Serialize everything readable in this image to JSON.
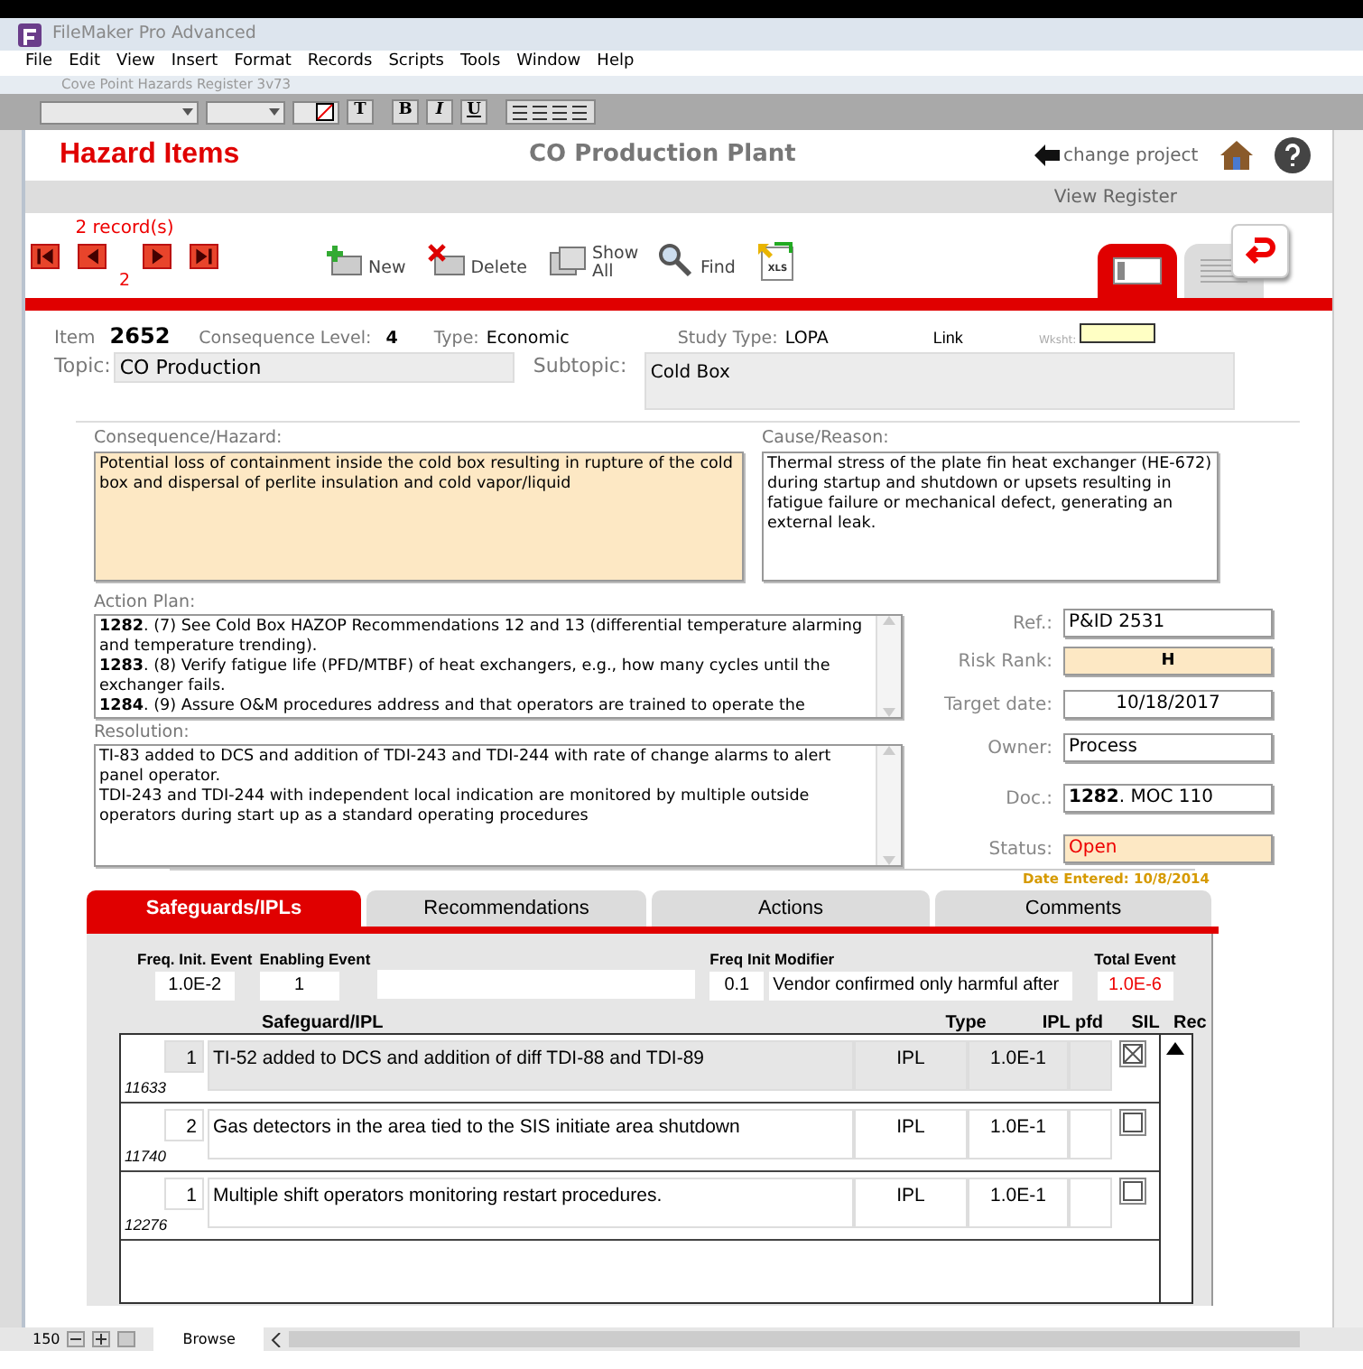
{
  "app_title": "FileMaker Pro Advanced",
  "menu": [
    "File",
    "Edit",
    "View",
    "Insert",
    "Format",
    "Records",
    "Scripts",
    "Tools",
    "Window",
    "Help"
  ],
  "document_title": "Cove Point Hazards Register 3v73",
  "format_buttons": [
    "T",
    "B",
    "I",
    "U"
  ],
  "header": {
    "title": "Hazard Items",
    "plant": "CO Production Plant",
    "change_project": "change project"
  },
  "subheader": "View Register",
  "records": {
    "count": "2 record(s)",
    "current": "2"
  },
  "toolbar": [
    {
      "kind": "new",
      "label": "New"
    },
    {
      "kind": "delete",
      "label": "Delete"
    },
    {
      "kind": "show_all",
      "label": "Show All"
    },
    {
      "kind": "find",
      "label": "Find"
    },
    {
      "kind": "xls",
      "label": "XLS"
    }
  ],
  "view_tabs": [
    {
      "kind": "form",
      "selected": true
    },
    {
      "kind": "list",
      "selected": false
    }
  ],
  "item": {
    "item_label": "Item",
    "item": "2652",
    "level_label": "Consequence Level:",
    "level": "4",
    "type_label": "Type:",
    "type": "Economic",
    "study_label": "Study Type:",
    "study": "LOPA",
    "link": "Link",
    "wksht": "Wksht:"
  },
  "topic": {
    "label": "Topic:",
    "value": "CO Production"
  },
  "subtopic": {
    "label": "Subtopic:",
    "value": "Cold Box"
  },
  "consequence": {
    "label": "Consequence/Hazard:",
    "value": "Potential loss of containment inside the cold box resulting in rupture of the cold box and dispersal of perlite insulation and cold vapor/liquid"
  },
  "cause": {
    "label": "Cause/Reason:",
    "value": "Thermal stress of the plate fin heat exchanger (HE-672) during startup and shutdown or upsets resulting in fatigue failure or mechanical defect, generating an external leak."
  },
  "action_plan": {
    "label": "Action Plan:",
    "entries": [
      "**1282**. (7) See Cold Box HAZOP Recommendations 12 and 13 (differential temperature alarming and temperature trending).",
      "**1283**. (8) Verify fatigue life (PFD/MTBF) of heat exchangers, e.g., how many cycles until the exchanger fails.",
      "**1284**. (9) Assure O&M procedures address and that operators are trained to operate the"
    ]
  },
  "resolution": {
    "label": "Resolution:",
    "entries": [
      "TI-83 added to DCS and addition of TDI-243 and TDI-244 with rate of change alarms to alert panel operator.",
      "TDI-243 and TDI-244 with independent local indication are monitored by multiple outside operators during start up as a standard operating procedures"
    ]
  },
  "side_fields": [
    {
      "label": "Ref.:",
      "value": "P&ID 2531",
      "kind": "plain"
    },
    {
      "label": "Risk Rank:",
      "value": "H",
      "kind": "rank"
    },
    {
      "label": "Target date:",
      "value": "10/18/2017",
      "kind": "date"
    },
    {
      "label": "Owner:",
      "value": "Process",
      "kind": "plain"
    },
    {
      "label": "Doc.:",
      "value": "**1282**. MOC 110",
      "kind": "plain"
    },
    {
      "label": "Status:",
      "value": "Open",
      "kind": "status"
    }
  ],
  "date_entered": "Date Entered: 10/8/2014",
  "tabs": [
    {
      "label": "Safeguards/IPLs",
      "selected": true
    },
    {
      "label": "Recommendations",
      "selected": false
    },
    {
      "label": "Actions",
      "selected": false
    },
    {
      "label": "Comments",
      "selected": false
    }
  ],
  "frequency": {
    "freq_label": "Freq. Init. Event",
    "freq": "1.0E-2",
    "enabling_label": "Enabling Event",
    "enabling": "1",
    "modifier_label": "Freq Init Modifier",
    "modifier": "0.1",
    "modifier_note": "Vendor confirmed only harmful after",
    "total_label": "Total Event",
    "total": "1.0E-6"
  },
  "safeguards": {
    "columns": [
      "Safeguard/IPL",
      "Type",
      "IPL pfd",
      "SIL",
      "Rec"
    ],
    "rows": [
      {
        "number": "1",
        "id": "11633",
        "text": "TI-52 added to DCS and addition of diff TDI-88 and TDI-89",
        "type": "IPL",
        "pfd": "1.0E-1",
        "rec": true,
        "selected": true
      },
      {
        "number": "2",
        "id": "11740",
        "text": "Gas detectors in the area tied to the SIS initiate area shutdown",
        "type": "IPL",
        "pfd": "1.0E-1",
        "rec": false,
        "selected": false
      },
      {
        "number": "1",
        "id": "12276",
        "text": "Multiple shift operators monitoring restart procedures.",
        "type": "IPL",
        "pfd": "1.0E-1",
        "rec": false,
        "selected": false
      }
    ]
  },
  "status_bar": {
    "zoom": "150",
    "mode": "Browse"
  }
}
